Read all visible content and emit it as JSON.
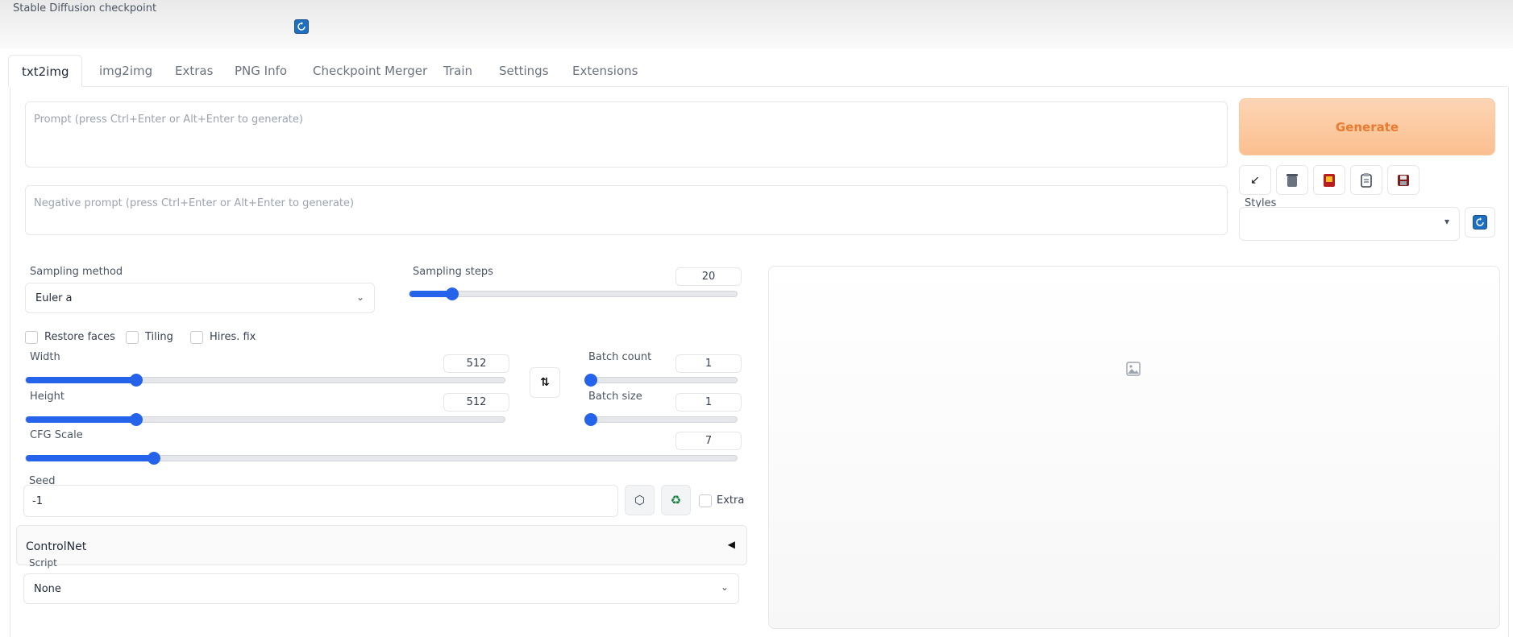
{
  "header": {
    "checkpoint_label": "Stable Diffusion checkpoint",
    "refresh_icon": "refresh-icon"
  },
  "tabs": [
    {
      "label": "txt2img",
      "active": true
    },
    {
      "label": "img2img",
      "active": false
    },
    {
      "label": "Extras",
      "active": false
    },
    {
      "label": "PNG Info",
      "active": false
    },
    {
      "label": "Checkpoint Merger",
      "active": false
    },
    {
      "label": "Train",
      "active": false
    },
    {
      "label": "Settings",
      "active": false
    },
    {
      "label": "Extensions",
      "active": false
    }
  ],
  "prompt": {
    "placeholder": "Prompt (press Ctrl+Enter or Alt+Enter to generate)",
    "value": ""
  },
  "negative_prompt": {
    "placeholder": "Negative prompt (press Ctrl+Enter or Alt+Enter to generate)",
    "value": ""
  },
  "generate_label": "Generate",
  "tools": [
    "arrow-icon",
    "trash-icon",
    "card-icon",
    "clipboard-icon",
    "save-icon"
  ],
  "styles": {
    "label": "Styles",
    "value": ""
  },
  "sampling_method": {
    "label": "Sampling method",
    "value": "Euler a"
  },
  "sampling_steps": {
    "label": "Sampling steps",
    "value": "20",
    "level": 0.13
  },
  "checkboxes": {
    "restore_faces": "Restore faces",
    "tiling": "Tiling",
    "hires_fix": "Hires. fix"
  },
  "width": {
    "label": "Width",
    "value": "512",
    "level": 0.23
  },
  "height": {
    "label": "Height",
    "value": "512",
    "level": 0.23
  },
  "batch_count": {
    "label": "Batch count",
    "value": "1",
    "level": 0.0
  },
  "batch_size": {
    "label": "Batch size",
    "value": "1",
    "level": 0.0
  },
  "cfg_scale": {
    "label": "CFG Scale",
    "value": "7",
    "level": 0.21
  },
  "seed": {
    "label": "Seed",
    "value": "-1",
    "extra_label": "Extra"
  },
  "controlnet": {
    "label": "ControlNet"
  },
  "script": {
    "label": "Script",
    "value": "None"
  },
  "colors": {
    "accent": "#2563eb",
    "generate_bg": "#fbbf8f",
    "generate_text": "#ea7a2f"
  }
}
